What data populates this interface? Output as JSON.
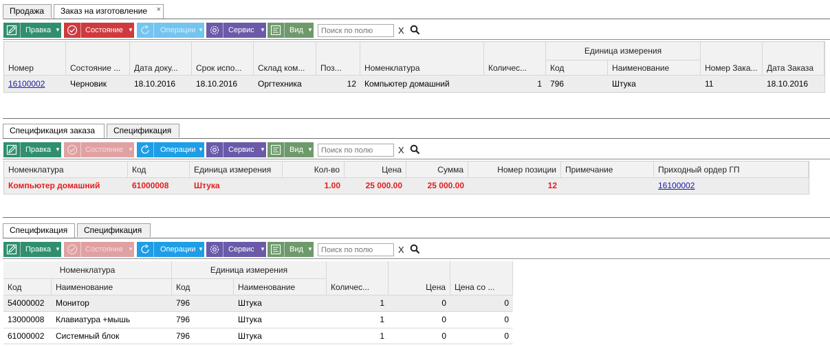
{
  "top_tabs": [
    "Продажа",
    "Заказ на изготовление"
  ],
  "toolbar": {
    "pravka": "Правка",
    "sostoyanie": "Состояние",
    "operatsii": "Операции",
    "servis": "Сервис",
    "vid": "Вид",
    "search_placeholder": "Поиск по полю",
    "clear": "X"
  },
  "colors": {
    "green": "#2f8f6e",
    "red": "#cf3a3e",
    "blue": "#1d9ee6",
    "purple": "#6a5aa8",
    "olive": "#6e9a6b",
    "link": "#1a1aa8",
    "highlight": "#e41d1d"
  },
  "orders": {
    "group_header": "Единица измерения",
    "columns": [
      "Номер",
      "Состояние ...",
      "Дата доку...",
      "Срок испо...",
      "Склад ком...",
      "Поз...",
      "Номенклатура",
      "Количес...",
      "Код",
      "Наименование",
      "Номер Зака...",
      "Дата Заказа"
    ],
    "rows": [
      [
        "16100002",
        "Черновик",
        "18.10.2016",
        "18.10.2016",
        "Оргтехника",
        "12",
        "Компьютер домашний",
        "1",
        "796",
        "Штука",
        "11",
        "18.10.2016"
      ]
    ]
  },
  "spec_tabs": [
    "Спецификация заказа",
    "Спецификация"
  ],
  "spec_order": {
    "columns": [
      "Номенклатура",
      "Код",
      "Единица измерения",
      "Кол-во",
      "Цена",
      "Сумма",
      "Номер позиции",
      "Примечание",
      "Приходный ордер ГП"
    ],
    "rows": [
      [
        "Компьютер домашний",
        "61000008",
        "Штука",
        "1.00",
        "25 000.00",
        "25 000.00",
        "12",
        "",
        "16100002"
      ]
    ]
  },
  "spec2_tabs": [
    "Спецификация",
    "Спецификация"
  ],
  "spec_items": {
    "group_nomenclature": "Номенклатура",
    "group_unit": "Единица измерения",
    "columns": [
      "Код",
      "Наименование",
      "Код",
      "Наименование",
      "Количес...",
      "Цена",
      "Цена со ..."
    ],
    "rows": [
      [
        "54000002",
        "Монитор",
        "796",
        "Штука",
        "1",
        "0",
        "0"
      ],
      [
        "13000008",
        "Клавиатура +мышь",
        "796",
        "Штука",
        "1",
        "0",
        "0"
      ],
      [
        "61000002",
        "Системный блок",
        "796",
        "Штука",
        "1",
        "0",
        "0"
      ]
    ]
  }
}
